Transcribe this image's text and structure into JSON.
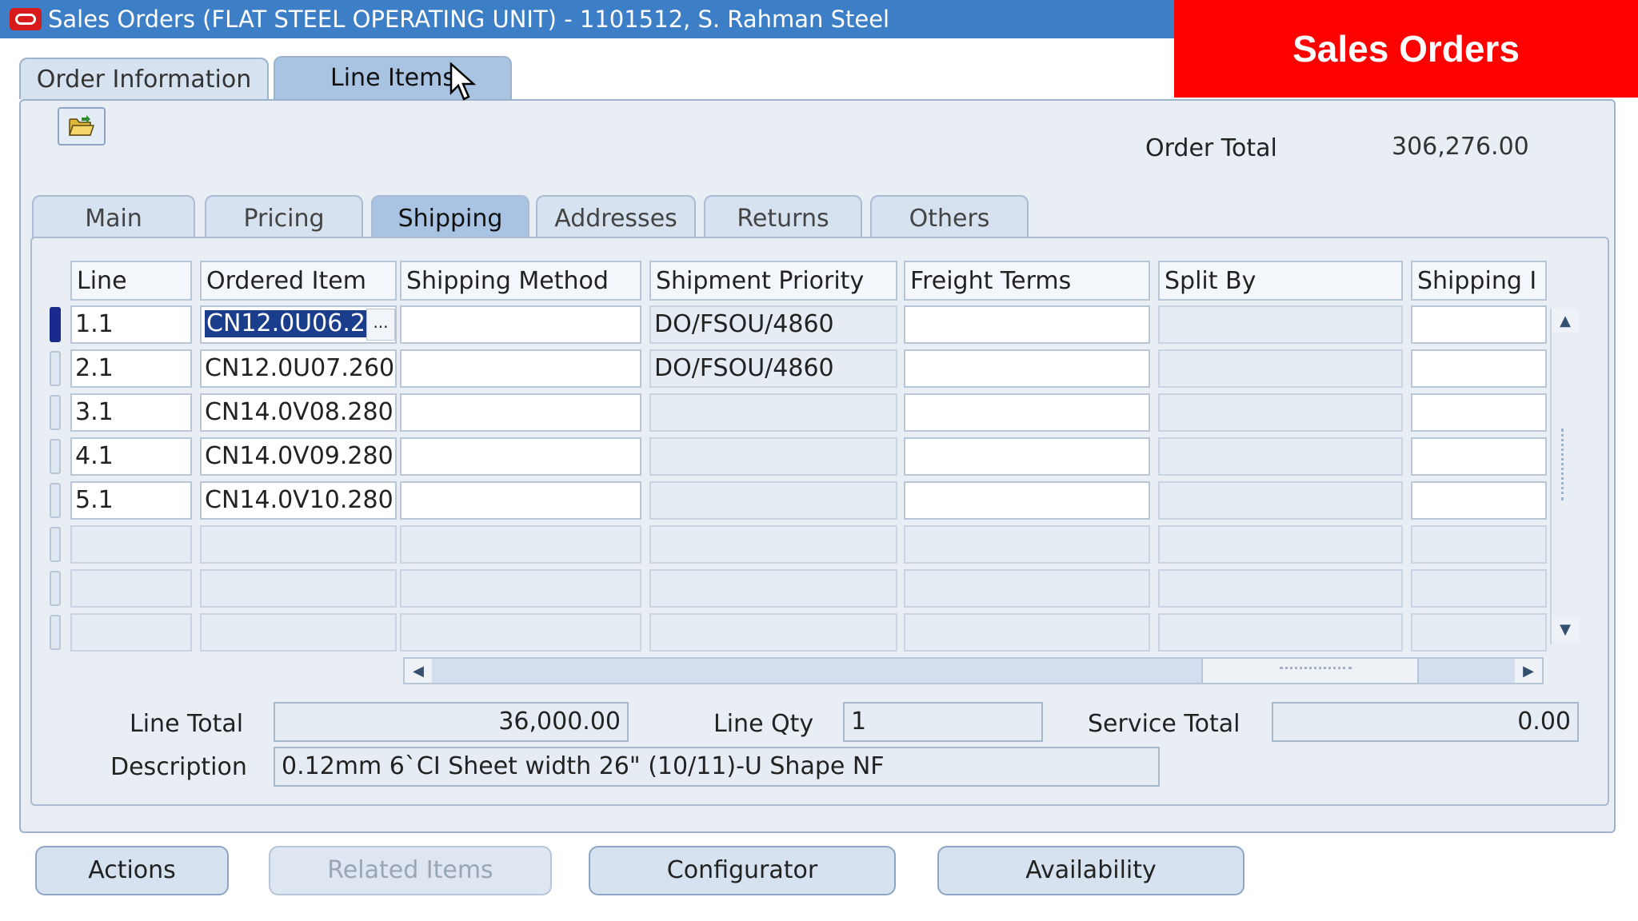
{
  "window": {
    "title": "Sales Orders (FLAT STEEL OPERATING UNIT) - 1101512, S. Rahman Steel",
    "banner": "Sales Orders"
  },
  "top_tabs": [
    {
      "label": "Order Information",
      "active": false
    },
    {
      "label": "Line Items",
      "active": true
    }
  ],
  "order_total": {
    "label": "Order Total",
    "value": "306,276.00"
  },
  "inner_tabs": [
    {
      "label": "Main",
      "active": false
    },
    {
      "label": "Pricing",
      "active": false
    },
    {
      "label": "Shipping",
      "active": true
    },
    {
      "label": "Addresses",
      "active": false
    },
    {
      "label": "Returns",
      "active": false
    },
    {
      "label": "Others",
      "active": false
    }
  ],
  "grid": {
    "columns": [
      "Line",
      "Ordered Item",
      "Shipping Method",
      "Shipment Priority",
      "Freight Terms",
      "Split By",
      "Shipping I"
    ],
    "rows": [
      {
        "line": "1.1",
        "ordered_item": "CN12.0U06.2",
        "shipping_method": "",
        "shipment_priority": "DO/FSOU/4860",
        "freight_terms": "",
        "split_by": "",
        "shipping_i": ""
      },
      {
        "line": "2.1",
        "ordered_item": "CN12.0U07.260",
        "shipping_method": "",
        "shipment_priority": "DO/FSOU/4860",
        "freight_terms": "",
        "split_by": "",
        "shipping_i": ""
      },
      {
        "line": "3.1",
        "ordered_item": "CN14.0V08.280",
        "shipping_method": "",
        "shipment_priority": "",
        "freight_terms": "",
        "split_by": "",
        "shipping_i": ""
      },
      {
        "line": "4.1",
        "ordered_item": "CN14.0V09.280",
        "shipping_method": "",
        "shipment_priority": "",
        "freight_terms": "",
        "split_by": "",
        "shipping_i": ""
      },
      {
        "line": "5.1",
        "ordered_item": "CN14.0V10.280",
        "shipping_method": "",
        "shipment_priority": "",
        "freight_terms": "",
        "split_by": "",
        "shipping_i": ""
      },
      {
        "line": "",
        "ordered_item": "",
        "shipping_method": "",
        "shipment_priority": "",
        "freight_terms": "",
        "split_by": "",
        "shipping_i": ""
      },
      {
        "line": "",
        "ordered_item": "",
        "shipping_method": "",
        "shipment_priority": "",
        "freight_terms": "",
        "split_by": "",
        "shipping_i": ""
      },
      {
        "line": "",
        "ordered_item": "",
        "shipping_method": "",
        "shipment_priority": "",
        "freight_terms": "",
        "split_by": "",
        "shipping_i": ""
      }
    ],
    "lov_button": "..."
  },
  "summary": {
    "line_total_label": "Line Total",
    "line_total_value": "36,000.00",
    "line_qty_label": "Line Qty",
    "line_qty_value": "1",
    "service_total_label": "Service Total",
    "service_total_value": "0.00",
    "description_label": "Description",
    "description_value": "0.12mm 6`CI Sheet width 26\"  (10/11)-U Shape NF"
  },
  "buttons": {
    "actions": "Actions",
    "related_items": "Related Items",
    "configurator": "Configurator",
    "availability": "Availability"
  },
  "colors": {
    "titlebar": "#3d7fc6",
    "banner": "#ff0000",
    "panel": "#e9eef5",
    "selection": "#1a3d8c"
  }
}
